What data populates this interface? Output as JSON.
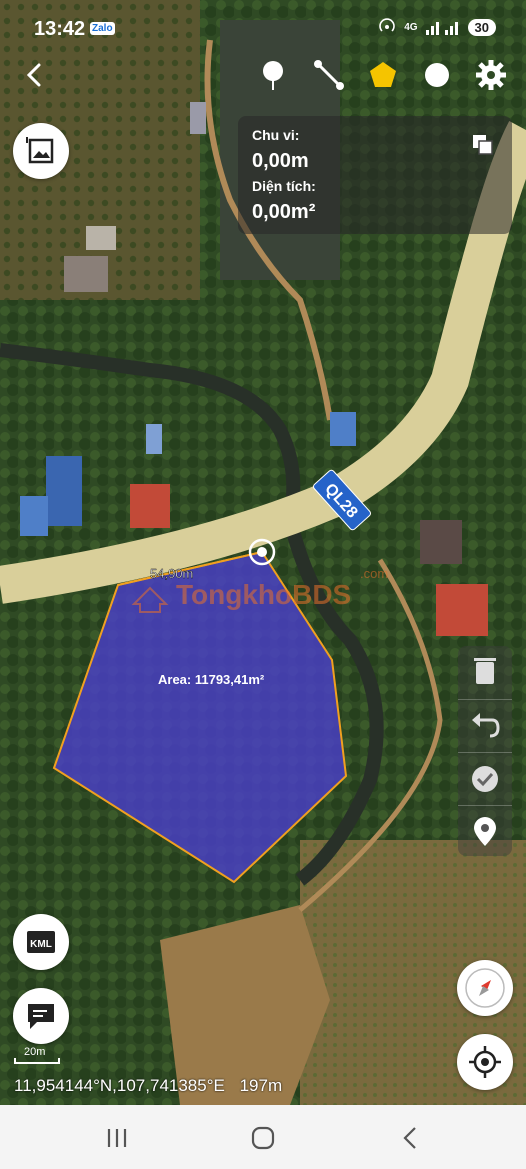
{
  "status_bar": {
    "time": "13:42",
    "zalo": "Zalo",
    "network": "4G",
    "battery": "30"
  },
  "info_panel": {
    "perimeter_label": "Chu vi:",
    "perimeter_value": "0,00m",
    "area_label": "Diện tích:",
    "area_value": "0,00m²"
  },
  "map": {
    "road_label": "QL28",
    "edge_length_label": "54,90m",
    "area_label": "Area: 11793,41m²",
    "watermark": "TongkhoBDS",
    "watermark_suffix": ".com",
    "scale_label": "20m",
    "coordinates": "11,954144°N,107,741385°E",
    "altitude": "197m"
  },
  "buttons": {
    "kml": "KML"
  },
  "colors": {
    "polygon_fill": "#4b3fc8",
    "polygon_stroke": "#f0a020",
    "road": "#d9cf9a",
    "active_tool": "#f5c400",
    "road_sign": "#2563c9"
  },
  "icons": [
    "back-icon",
    "pin-icon",
    "line-icon",
    "polygon-icon",
    "circle-icon",
    "settings-icon",
    "image-icon",
    "copy-icon",
    "trash-icon",
    "undo-icon",
    "check-icon",
    "location-pin-icon",
    "kml-icon",
    "note-icon",
    "compass-icon",
    "my-location-icon",
    "recent-apps-icon",
    "home-icon",
    "nav-back-icon"
  ]
}
